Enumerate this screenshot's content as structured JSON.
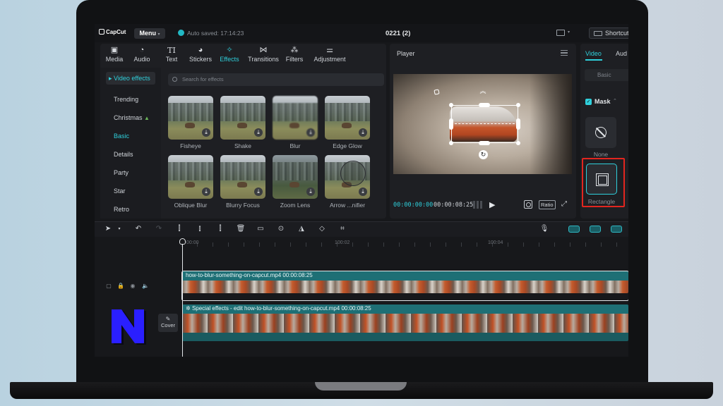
{
  "app": {
    "logo": "CapCut",
    "menu_label": "Menu",
    "autosave": "Auto saved: 17:14:23",
    "project_title": "0221 (2)",
    "shortcut_label": "Shortcut"
  },
  "tabs": [
    {
      "label": "Media",
      "icon": "media-icon",
      "active": false
    },
    {
      "label": "Audio",
      "icon": "audio-icon",
      "active": false
    },
    {
      "label": "Text",
      "icon": "text-icon",
      "active": false
    },
    {
      "label": "Stickers",
      "icon": "stickers-icon",
      "active": false
    },
    {
      "label": "Effects",
      "icon": "effects-icon",
      "active": true
    },
    {
      "label": "Transitions",
      "icon": "transitions-icon",
      "active": false
    },
    {
      "label": "Filters",
      "icon": "filters-icon",
      "active": false
    },
    {
      "label": "Adjustment",
      "icon": "adjustment-icon",
      "active": false
    }
  ],
  "sidebar": {
    "header": "Video effects",
    "items": [
      "Trending",
      "Christmas",
      "Basic",
      "Details",
      "Party",
      "Star",
      "Retro"
    ],
    "active_item": "Basic"
  },
  "search": {
    "placeholder": "Search for effects"
  },
  "effects": [
    "Fisheye",
    "Shake",
    "Blur",
    "Edge Glow",
    "Oblique Blur",
    "Blurry Focus",
    "Zoom Lens",
    "Arrow ...nifier"
  ],
  "player": {
    "title": "Player",
    "current_time": "00:00:00:00",
    "total_time": "00:00:08:25",
    "ratio_label": "Ratio"
  },
  "right_panel": {
    "tab_video": "Video",
    "tab_audio": "Aud",
    "basic_label": "Basic",
    "mask_label": "Mask",
    "mask_options": [
      {
        "label": "None",
        "icon": "none-icon",
        "selected": false
      },
      {
        "label": "Rectangle",
        "icon": "rectangle-icon",
        "selected": true
      }
    ]
  },
  "timeline": {
    "ruler_labels": [
      "00:00",
      "100:02",
      "100:04"
    ],
    "video_clip_title": "how-to-blur-something-on-capcut.mp4  00:00:08:25",
    "effect_clip_title": "Special effects - edit  how-to-blur-something-on-capcut.mp4  00:00:08:25",
    "cover_label": "Cover"
  },
  "colors": {
    "accent": "#2fd0dc",
    "highlight": "#e2261f",
    "clip": "#1e6f75",
    "logo_blue": "#2a1fff"
  }
}
